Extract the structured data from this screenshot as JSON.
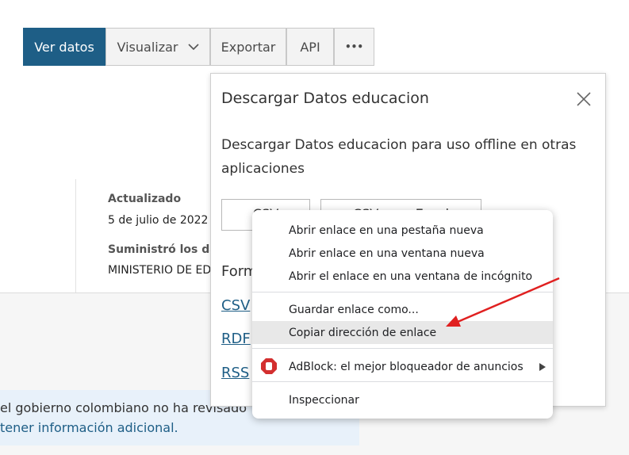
{
  "toolbar": {
    "view_data": "Ver datos",
    "visualize": "Visualizar",
    "export": "Exportar",
    "api": "API",
    "more": "•••"
  },
  "meta": {
    "updated_label": "Actualizado",
    "updated_value": "5 de julio de 2022",
    "supplied_label": "Suministró los dat",
    "supplied_value": "MINISTERIO DE ED"
  },
  "notice": {
    "line1": "el gobierno colombiano no ha revisado",
    "line2": "tener información adicional."
  },
  "modal": {
    "title": "Descargar Datos educacion",
    "description": "Descargar Datos educacion para uso offline en otras aplicaciones",
    "button_csv": "CSV",
    "button_csv_excel": "CSV para Excel",
    "formats_label": "Form",
    "links": [
      "CSV",
      "RDF",
      "RSS"
    ]
  },
  "context_menu": {
    "items": [
      "Abrir enlace en una pestaña nueva",
      "Abrir enlace en una ventana nueva",
      "Abrir el enlace en una ventana de incógnito",
      "Guardar enlace como...",
      "Copiar dirección de enlace",
      "AdBlock: el mejor bloqueador de anuncios",
      "Inspeccionar"
    ],
    "highlighted_index": 4
  },
  "colors": {
    "primary": "#1e5e86",
    "arrow": "#e02020",
    "adblock": "#d32f2f"
  }
}
